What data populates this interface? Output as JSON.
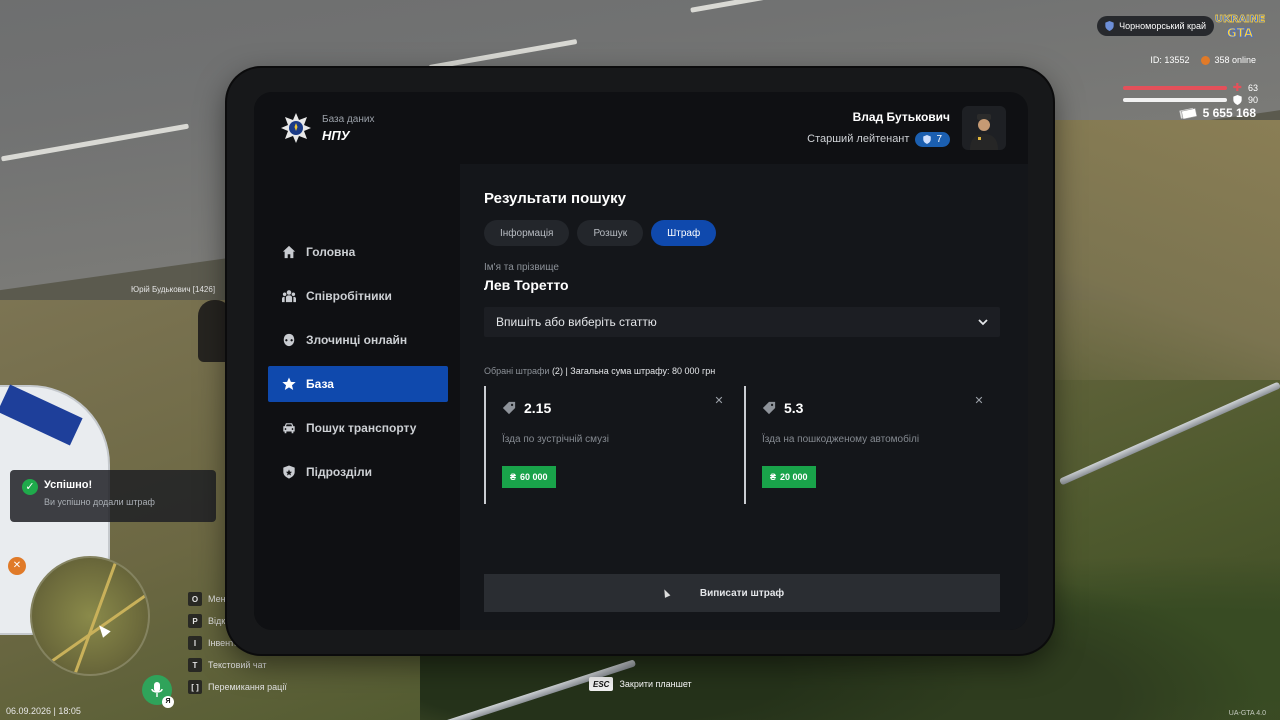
{
  "hud": {
    "server_name": "Чорноморський край",
    "logo_line1": "UKRAINE",
    "logo_line2": "GTA",
    "player_id": "ID: 13552",
    "online": "358 online",
    "health": "63",
    "armor": "90",
    "money": "5 655 168",
    "datetime": "06.09.2026 | 18:05",
    "nametag": "Юрій Будькович [1426]",
    "mic_key": "Я",
    "watermark": "UA-GTA 4.0",
    "colors": {
      "health": "#e4505a",
      "armor": "#ffffff",
      "accent": "#0f49ad",
      "success": "#19a34a"
    }
  },
  "keybinds": [
    {
      "key": "O",
      "label": "Меню"
    },
    {
      "key": "P",
      "label": "Відкрити"
    },
    {
      "key": "I",
      "label": "Інвентар"
    },
    {
      "key": "T",
      "label": "Текстовий чат"
    },
    {
      "key": "[ ]",
      "label": "Перемикання рації"
    }
  ],
  "esc_hint": {
    "key": "ESC",
    "label": "Закрити планшет"
  },
  "toast": {
    "title": "Успішно!",
    "message": "Ви успішно додали штраф"
  },
  "tablet": {
    "brand": {
      "subtitle": "База даних",
      "title": "НПУ"
    },
    "user": {
      "name": "Влад Бутькович",
      "rank": "Старший лейтенант",
      "rank_level": "7"
    },
    "nav": [
      {
        "label": "Головна",
        "icon": "home-icon"
      },
      {
        "label": "Співробітники",
        "icon": "people-icon"
      },
      {
        "label": "Злочинці онлайн",
        "icon": "mask-icon"
      },
      {
        "label": "База",
        "icon": "star-icon",
        "active": true
      },
      {
        "label": "Пошук транспорту",
        "icon": "car-icon"
      },
      {
        "label": "Підрозділи",
        "icon": "shield-icon"
      }
    ],
    "content": {
      "title": "Результати пошуку",
      "tabs": [
        {
          "label": "Інформація"
        },
        {
          "label": "Розшук"
        },
        {
          "label": "Штраф",
          "active": true
        }
      ],
      "name_label": "Ім'я та прізвище",
      "name_value": "Лев Торетто",
      "article_select_placeholder": "Впишіть або виберіть статтю",
      "summary_prefix": "Обрані штрафи",
      "summary_count": "(2)",
      "summary_total": "| Загальна сума штрафу: 80 000 грн",
      "fines": [
        {
          "code": "2.15",
          "description": "Їзда по зустрічній смузі",
          "amount": "60 000"
        },
        {
          "code": "5.3",
          "description": "Їзда на пошкодженому автомобілі",
          "amount": "20 000"
        }
      ],
      "submit_label": "Виписати штраф"
    }
  }
}
